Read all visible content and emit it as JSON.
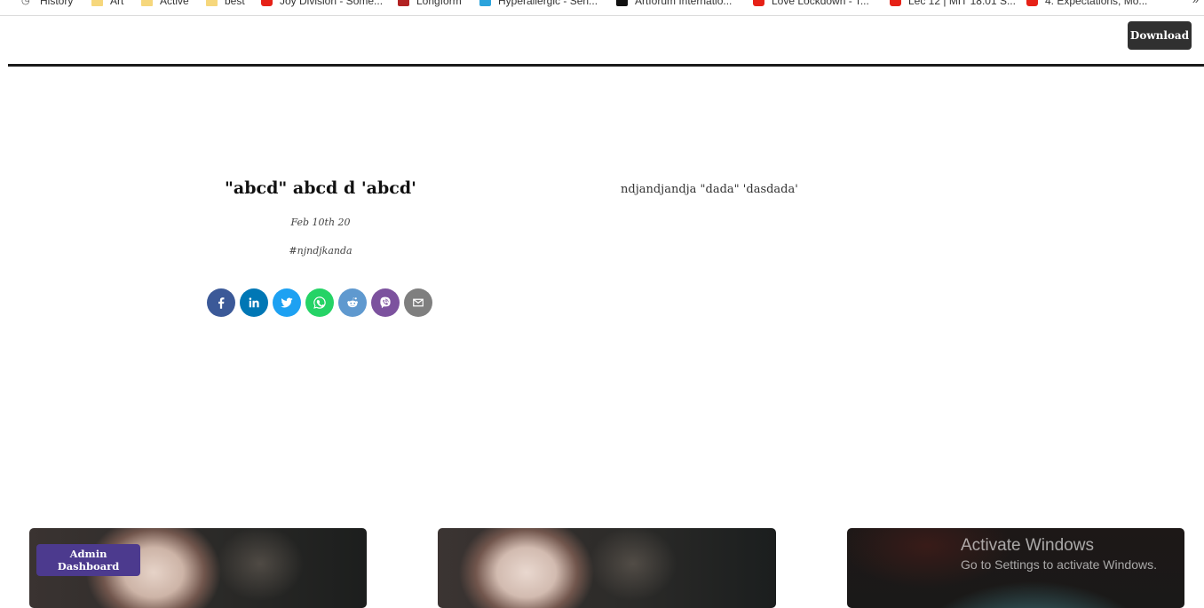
{
  "bookmarks": [
    {
      "label": "History",
      "icon": "history-icon"
    },
    {
      "label": "Art",
      "icon": "folder-icon"
    },
    {
      "label": "Active",
      "icon": "folder-icon"
    },
    {
      "label": "best",
      "icon": "folder-icon"
    },
    {
      "label": "Joy Division - Some...",
      "icon": "youtube-icon"
    },
    {
      "label": "Longform",
      "icon": "longform-icon"
    },
    {
      "label": "Hyperallergic - Sen...",
      "icon": "hyperallergic-icon"
    },
    {
      "label": "Artforum Internatio...",
      "icon": "artforum-icon"
    },
    {
      "label": "Love Lockdown - T...",
      "icon": "youtube-icon"
    },
    {
      "label": "Lec 12 | MIT 18.01 S...",
      "icon": "youtube-icon"
    },
    {
      "label": "4. Expectations, Mo...",
      "icon": "youtube-icon"
    }
  ],
  "bookmarks_more": "»",
  "header": {
    "download_label": "Download"
  },
  "post": {
    "title": "\"abcd\" abcd d 'abcd'",
    "date": "Feb 10th 20",
    "tag": "#njndjkanda",
    "body": "ndjandjandja \"dada\" 'dasdada'"
  },
  "share_buttons": [
    {
      "name": "facebook",
      "color": "#3b5998"
    },
    {
      "name": "linkedin",
      "color": "#0077b5"
    },
    {
      "name": "twitter",
      "color": "#1da1f2"
    },
    {
      "name": "whatsapp",
      "color": "#25d366"
    },
    {
      "name": "reddit",
      "color": "#5f99cf"
    },
    {
      "name": "viber",
      "color": "#7c529e"
    },
    {
      "name": "email",
      "color": "#7f7f7f"
    }
  ],
  "admin": {
    "label": "Admin Dashboard"
  },
  "watermark": {
    "line1": "Activate Windows",
    "line2": "Go to Settings to activate Windows."
  }
}
